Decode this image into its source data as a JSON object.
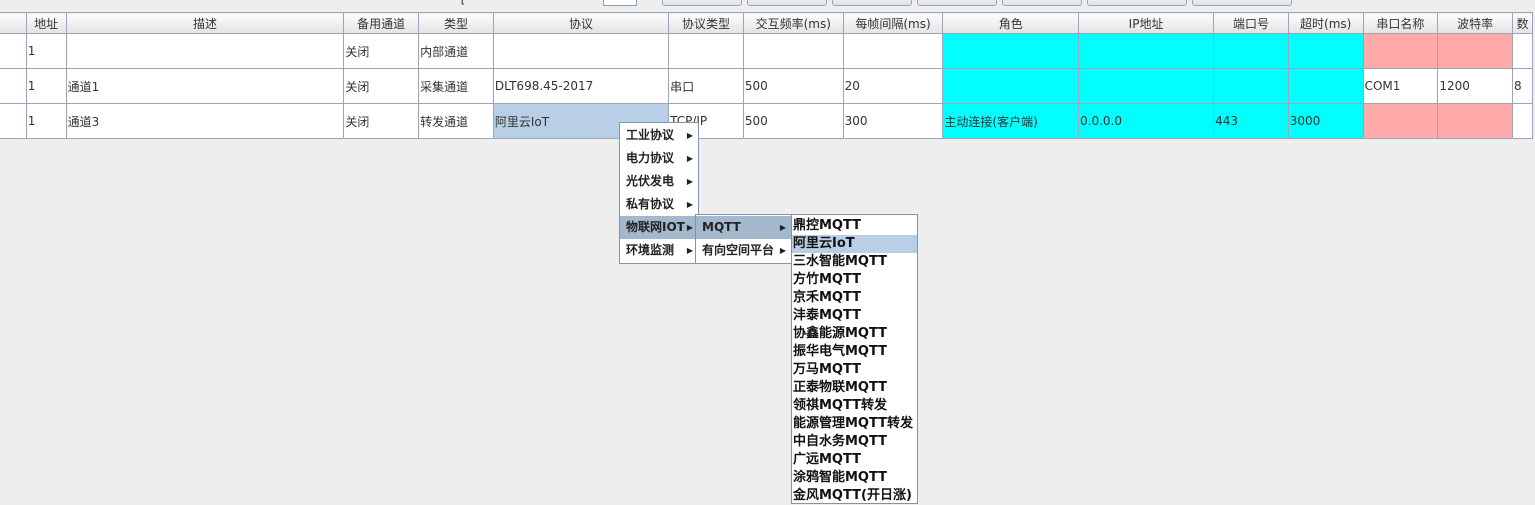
{
  "toolbar": {
    "label": "--[- --- -",
    "spinner_value": ""
  },
  "table": {
    "headers": [
      "地址",
      "描述",
      "备用通道",
      "类型",
      "协议",
      "协议类型",
      "交互频率(ms)",
      "每帧间隔(ms)",
      "角色",
      "IP地址",
      "端口号",
      "超时(ms)",
      "串口名称",
      "波特率",
      "数"
    ],
    "rows": [
      [
        "1",
        "",
        "关闭",
        "内部通道",
        "",
        "",
        "",
        "",
        "",
        "",
        "",
        "",
        "",
        "",
        ""
      ],
      [
        "1",
        "通道1",
        "关闭",
        "采集通道",
        "DLT698.45-2017",
        "串口",
        "500",
        "20",
        "",
        "",
        "",
        "",
        "COM1",
        "1200",
        "8"
      ],
      [
        "1",
        "通道3",
        "关闭",
        "转发通道",
        "阿里云IoT",
        "TCP/IP",
        "500",
        "300",
        "主动连接(客户端)",
        "0.0.0.0",
        "443",
        "3000",
        "",
        "",
        ""
      ]
    ]
  },
  "menu": {
    "level1": [
      "工业协议",
      "电力协议",
      "光伏发电",
      "私有协议",
      "物联网IOT",
      "环境监测"
    ],
    "level2": [
      "MQTT",
      "有向空间平台"
    ],
    "level3": [
      "鼎控MQTT",
      "阿里云IoT",
      "三水智能MQTT",
      "方竹MQTT",
      "京禾MQTT",
      "沣泰MQTT",
      "协鑫能源MQTT",
      "振华电气MQTT",
      "万马MQTT",
      "正泰物联MQTT",
      "领祺MQTT转发",
      "能源管理MQTT转发",
      "中自水务MQTT",
      "广远MQTT",
      "涂鸦智能MQTT",
      "金风MQTT(开日涨)"
    ]
  },
  "colors": {
    "cyan_cell": "#00ffff",
    "pink_cell": "#ffaaaa",
    "selected_cell": "#b8cfe5",
    "menu_active": "#a3b8cc"
  }
}
